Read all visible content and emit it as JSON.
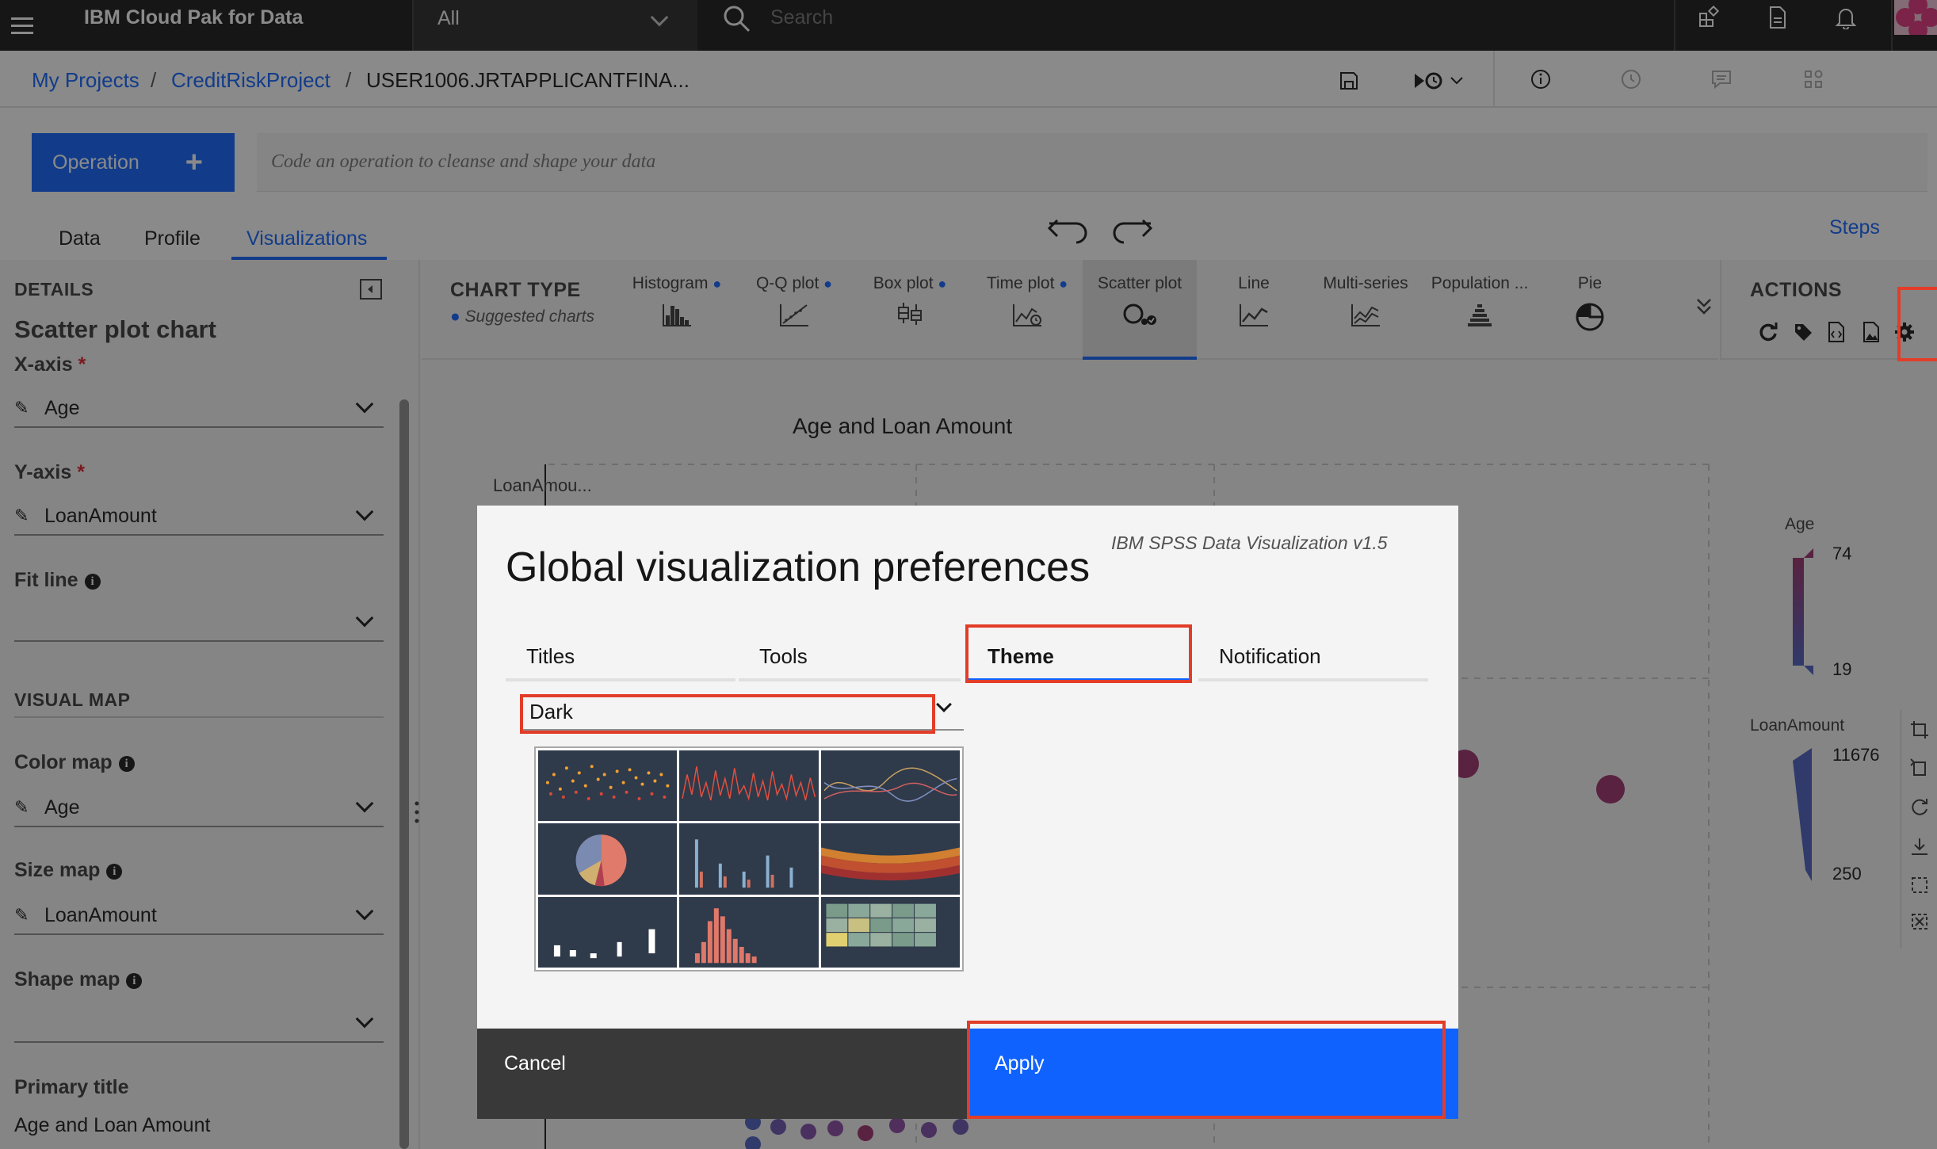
{
  "topbar": {
    "brand": "IBM Cloud Pak for Data",
    "scope": "All",
    "search_placeholder": "Search"
  },
  "breadcrumb": {
    "items": [
      "My Projects",
      "CreditRiskProject",
      "USER1006.JRTAPPLICANTFINA..."
    ],
    "separator": "/"
  },
  "operation": {
    "button_label": "Operation",
    "plus": "+",
    "input_placeholder": "Code an operation to cleanse and shape your data"
  },
  "tabs": {
    "data": "Data",
    "profile": "Profile",
    "visualizations": "Visualizations",
    "steps": "Steps"
  },
  "details": {
    "section": "DETAILS",
    "chart_name": "Scatter plot chart",
    "x_axis_label": "X-axis",
    "x_axis_value": "Age",
    "y_axis_label": "Y-axis",
    "y_axis_value": "LoanAmount",
    "required_mark": "*",
    "fit_line_label": "Fit line",
    "fit_line_value": "",
    "visual_map_section": "VISUAL MAP",
    "color_map_label": "Color map",
    "color_map_value": "Age",
    "size_map_label": "Size map",
    "size_map_value": "LoanAmount",
    "shape_map_label": "Shape map",
    "shape_map_value": "",
    "primary_title_label": "Primary title",
    "primary_title_value": "Age and Loan Amount",
    "info_glyph": "i",
    "ruler_glyph": "✎"
  },
  "chart_type": {
    "title": "CHART TYPE",
    "suggested": "Suggested charts",
    "dot": "●",
    "items": [
      {
        "label": "Histogram",
        "suggested": true
      },
      {
        "label": "Q-Q plot",
        "suggested": true
      },
      {
        "label": "Box plot",
        "suggested": true
      },
      {
        "label": "Time plot",
        "suggested": true
      },
      {
        "label": "Scatter plot",
        "suggested": false,
        "active": true
      },
      {
        "label": "Line",
        "suggested": false
      },
      {
        "label": "Multi-series",
        "suggested": false
      },
      {
        "label": "Population ...",
        "suggested": false
      },
      {
        "label": "Pie",
        "suggested": false
      }
    ]
  },
  "actions": {
    "title": "ACTIONS"
  },
  "chart": {
    "title": "Age and Loan Amount",
    "y_label": "LoanAmou...",
    "legend_age_title": "Age",
    "legend_age_max": "74",
    "legend_age_min": "19",
    "legend_loan_title": "LoanAmount",
    "legend_loan_max": "11676",
    "legend_loan_min": "250",
    "accent_color": "#9b2e6a"
  },
  "modal": {
    "version": "IBM SPSS Data Visualization v1.5",
    "title": "Global visualization preferences",
    "tabs": [
      "Titles",
      "Tools",
      "Theme",
      "Notification"
    ],
    "active_tab": "Theme",
    "theme_value": "Dark",
    "cancel_label": "Cancel",
    "apply_label": "Apply"
  },
  "colors": {
    "primary": "#0f62fe",
    "highlight": "#e23d28",
    "topbar": "#161616"
  }
}
